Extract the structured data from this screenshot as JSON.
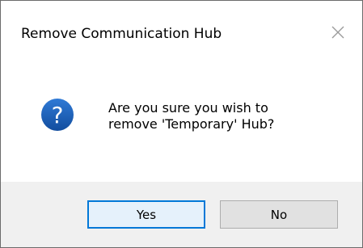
{
  "dialog": {
    "title": "Remove Communication Hub",
    "message_line1": "Are you sure you wish to",
    "message_line2": "remove 'Temporary' Hub?",
    "icon": "question-icon",
    "buttons": {
      "yes_label": "Yes",
      "no_label": "No"
    }
  },
  "colors": {
    "icon_blue": "#1c5fb8",
    "focus_border": "#0078d7",
    "footer_bg": "#f0f0f0"
  }
}
